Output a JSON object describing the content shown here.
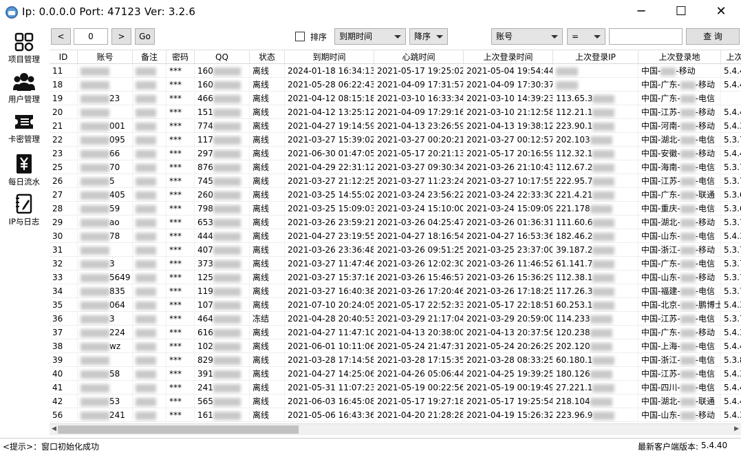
{
  "window": {
    "title": "Ip: 0.0.0.0  Port: 47123  Ver: 3.2.6",
    "minimize": "─",
    "maximize": "☐",
    "close": "✕"
  },
  "sidebar": {
    "items": [
      {
        "label": "项目管理",
        "icon": "grid-icon"
      },
      {
        "label": "用户管理",
        "icon": "users-icon"
      },
      {
        "label": "卡密管理",
        "icon": "ticket-icon"
      },
      {
        "label": "每日流水",
        "icon": "yen-icon"
      },
      {
        "label": "IP与日志",
        "icon": "notebook-icon"
      }
    ]
  },
  "toolbar": {
    "prev": "<",
    "page": "0",
    "next": ">",
    "go": "Go",
    "sort_label": "排序",
    "sort_field": "到期时间",
    "sort_order": "降序",
    "filter_field": "账号",
    "filter_op": "=",
    "filter_value": "",
    "query": "查 询"
  },
  "table": {
    "columns": [
      "ID",
      "账号",
      "备注",
      "密码",
      "QQ",
      "状态",
      "到期时间",
      "心跳时间",
      "上次登录时间",
      "上次登录IP",
      "上次登录地",
      "上次"
    ],
    "rows": [
      {
        "id": "11",
        "acct": "",
        "note": "",
        "pwd": "***",
        "qq": "160",
        "status": "离线",
        "expire": "2024-01-18 16:34:13",
        "beat": "2021-05-17 19:25:02",
        "last": "2021-05-04 19:54:44",
        "ip": "",
        "loc_a": "中国-",
        "loc_b": "-移动",
        "ver": "5.4.4"
      },
      {
        "id": "18",
        "acct": "",
        "note": "",
        "pwd": "***",
        "qq": "160",
        "status": "离线",
        "expire": "2021-05-28 06:22:43",
        "beat": "2021-04-09 17:31:57",
        "last": "2021-04-09 17:30:37",
        "ip": "",
        "loc_a": "中国-广东-",
        "loc_b": "-移动",
        "ver": "5.4.4"
      },
      {
        "id": "19",
        "acct": "23",
        "note": "",
        "pwd": "***",
        "qq": "466",
        "status": "离线",
        "expire": "2021-04-12 08:15:18",
        "beat": "2021-03-10 16:33:34",
        "last": "2021-03-10 14:39:23",
        "ip": "113.65.3",
        "loc_a": "中国-广东-",
        "loc_b": "-电信",
        "ver": ""
      },
      {
        "id": "20",
        "acct": "",
        "note": "",
        "pwd": "***",
        "qq": "151",
        "status": "离线",
        "expire": "2021-04-12 13:25:12",
        "beat": "2021-04-09 17:29:16",
        "last": "2021-03-10 21:12:58",
        "ip": "112.21.1",
        "loc_a": "中国-江苏-",
        "loc_b": "-移动",
        "ver": "5.4.4"
      },
      {
        "id": "21",
        "acct": "001",
        "note": "",
        "pwd": "***",
        "qq": "774",
        "status": "离线",
        "expire": "2021-04-27 19:14:59",
        "beat": "2021-04-13 23:26:59",
        "last": "2021-04-13 19:38:12",
        "ip": "223.90.1",
        "loc_a": "中国-河南-",
        "loc_b": "-移动",
        "ver": "5.4.3"
      },
      {
        "id": "22",
        "acct": "095",
        "note": "",
        "pwd": "***",
        "qq": "117",
        "status": "离线",
        "expire": "2021-03-27 15:39:02",
        "beat": "2021-03-27 00:20:21",
        "last": "2021-03-27 00:12:57",
        "ip": "202.103",
        "loc_a": "中国-湖北-",
        "loc_b": "-电信",
        "ver": "5.3.7"
      },
      {
        "id": "23",
        "acct": "66",
        "note": "",
        "pwd": "***",
        "qq": "297",
        "status": "离线",
        "expire": "2021-06-30 01:47:05",
        "beat": "2021-05-17 20:21:13",
        "last": "2021-05-17 20:16:59",
        "ip": "112.32.1",
        "loc_a": "中国-安徽-",
        "loc_b": "-移动",
        "ver": "5.4.4"
      },
      {
        "id": "25",
        "acct": "70",
        "note": "",
        "pwd": "***",
        "qq": "876",
        "status": "离线",
        "expire": "2021-04-29 22:31:12",
        "beat": "2021-03-27 09:30:34",
        "last": "2021-03-26 21:10:43",
        "ip": "112.67.2",
        "loc_a": "中国-海南-",
        "loc_b": "-电信",
        "ver": "5.3.7"
      },
      {
        "id": "26",
        "acct": "5",
        "note": "",
        "pwd": "***",
        "qq": "745",
        "status": "离线",
        "expire": "2021-03-27 21:12:25",
        "beat": "2021-03-27 11:23:24",
        "last": "2021-03-27 10:17:55",
        "ip": "222.95.7",
        "loc_a": "中国-江苏-",
        "loc_b": "-电信",
        "ver": "5.3.7"
      },
      {
        "id": "27",
        "acct": "405",
        "note": "",
        "pwd": "***",
        "qq": "260",
        "status": "离线",
        "expire": "2021-03-25 14:55:02",
        "beat": "2021-03-24 23:56:22",
        "last": "2021-03-24 22:33:30",
        "ip": "221.4.21",
        "loc_a": "中国-广东-",
        "loc_b": "-联通",
        "ver": "5.3.6"
      },
      {
        "id": "28",
        "acct": "59",
        "note": "",
        "pwd": "***",
        "qq": "798",
        "status": "离线",
        "expire": "2021-03-25 15:09:03",
        "beat": "2021-03-24 15:10:00",
        "last": "2021-03-24 15:09:09",
        "ip": "221.178",
        "loc_a": "中国-重庆-",
        "loc_b": "-电信",
        "ver": "5.3.6"
      },
      {
        "id": "29",
        "acct": "ao",
        "note": "",
        "pwd": "***",
        "qq": "653",
        "status": "离线",
        "expire": "2021-03-26 23:59:21",
        "beat": "2021-03-26 04:25:47",
        "last": "2021-03-26 01:36:31",
        "ip": "111.60.6",
        "loc_a": "中国-湖北-",
        "loc_b": "-移动",
        "ver": "5.3.7"
      },
      {
        "id": "30",
        "acct": "78",
        "note": "",
        "pwd": "***",
        "qq": "444",
        "status": "离线",
        "expire": "2021-04-27 23:19:55",
        "beat": "2021-04-27 18:16:54",
        "last": "2021-04-27 16:53:36",
        "ip": "182.46.2",
        "loc_a": "中国-山东-",
        "loc_b": "-电信",
        "ver": "5.4.3"
      },
      {
        "id": "31",
        "acct": "",
        "note": "",
        "pwd": "***",
        "qq": "407",
        "status": "离线",
        "expire": "2021-03-26 23:36:48",
        "beat": "2021-03-26 09:51:25",
        "last": "2021-03-25 23:37:00",
        "ip": "39.187.2",
        "loc_a": "中国-浙江-",
        "loc_b": "-移动",
        "ver": "5.3.7"
      },
      {
        "id": "32",
        "acct": "3",
        "note": "",
        "pwd": "***",
        "qq": "373",
        "status": "离线",
        "expire": "2021-03-27 11:47:46",
        "beat": "2021-03-26 12:02:30",
        "last": "2021-03-26 11:46:52",
        "ip": "61.141.7",
        "loc_a": "中国-广东-",
        "loc_b": "-电信",
        "ver": "5.3.7"
      },
      {
        "id": "33",
        "acct": "5649",
        "note": "",
        "pwd": "***",
        "qq": "125",
        "status": "离线",
        "expire": "2021-03-27 15:37:16",
        "beat": "2021-03-26 15:46:57",
        "last": "2021-03-26 15:36:29",
        "ip": "112.38.1",
        "loc_a": "中国-山东-",
        "loc_b": "-移动",
        "ver": "5.3.7"
      },
      {
        "id": "34",
        "acct": "835",
        "note": "",
        "pwd": "***",
        "qq": "119",
        "status": "离线",
        "expire": "2021-03-27 16:40:38",
        "beat": "2021-03-26 17:20:46",
        "last": "2021-03-26 17:18:25",
        "ip": "117.26.3",
        "loc_a": "中国-福建-",
        "loc_b": "-电信",
        "ver": "5.3.7"
      },
      {
        "id": "35",
        "acct": "064",
        "note": "",
        "pwd": "***",
        "qq": "107",
        "status": "离线",
        "expire": "2021-07-10 20:24:05",
        "beat": "2021-05-17 22:52:33",
        "last": "2021-05-17 22:18:51",
        "ip": "60.253.1",
        "loc_a": "中国-北京-",
        "loc_b": "-鹏博士",
        "ver": "5.4.3"
      },
      {
        "id": "36",
        "acct": "3",
        "note": "",
        "pwd": "***",
        "qq": "464",
        "status": "冻结",
        "expire": "2021-04-28 20:40:53",
        "beat": "2021-03-29 21:17:04",
        "last": "2021-03-29 20:59:00",
        "ip": "114.233",
        "loc_a": "中国-江苏-",
        "loc_b": "-电信",
        "ver": "5.3.7"
      },
      {
        "id": "37",
        "acct": "224",
        "note": "",
        "pwd": "***",
        "qq": "616",
        "status": "离线",
        "expire": "2021-04-27 11:47:10",
        "beat": "2021-04-13 20:38:00",
        "last": "2021-04-13 20:37:56",
        "ip": "120.238",
        "loc_a": "中国-广东-",
        "loc_b": "-移动",
        "ver": "5.4.3"
      },
      {
        "id": "38",
        "acct": "wz",
        "note": "",
        "pwd": "***",
        "qq": "102",
        "status": "离线",
        "expire": "2021-06-01 10:11:06",
        "beat": "2021-05-24 21:47:31",
        "last": "2021-05-24 20:26:29",
        "ip": "202.120",
        "loc_a": "中国-上海-",
        "loc_b": "-电信",
        "ver": "5.4.4"
      },
      {
        "id": "39",
        "acct": "",
        "note": "",
        "pwd": "***",
        "qq": "829",
        "status": "离线",
        "expire": "2021-03-28 17:14:58",
        "beat": "2021-03-28 17:15:35",
        "last": "2021-03-28 08:33:25",
        "ip": "60.180.1",
        "loc_a": "中国-浙江-",
        "loc_b": "-电信",
        "ver": "5.3.8"
      },
      {
        "id": "40",
        "acct": "58",
        "note": "",
        "pwd": "***",
        "qq": "391",
        "status": "离线",
        "expire": "2021-04-27 14:25:06",
        "beat": "2021-04-26 05:06:44",
        "last": "2021-04-25 19:39:25",
        "ip": "180.126",
        "loc_a": "中国-江苏-",
        "loc_b": "-电信",
        "ver": "5.4.3"
      },
      {
        "id": "41",
        "acct": "",
        "note": "",
        "pwd": "***",
        "qq": "241",
        "status": "离线",
        "expire": "2021-05-31 11:07:23",
        "beat": "2021-05-19 00:22:56",
        "last": "2021-05-19 00:19:49",
        "ip": "27.221.1",
        "loc_a": "中国-四川-",
        "loc_b": "-电信",
        "ver": "5.4.4"
      },
      {
        "id": "42",
        "acct": "53",
        "note": "",
        "pwd": "***",
        "qq": "565",
        "status": "离线",
        "expire": "2021-06-03 16:45:08",
        "beat": "2021-05-17 19:27:18",
        "last": "2021-05-17 19:25:54",
        "ip": "218.104",
        "loc_a": "中国-湖北-",
        "loc_b": "-联通",
        "ver": "5.4.4"
      },
      {
        "id": "56",
        "acct": "241",
        "note": "",
        "pwd": "***",
        "qq": "161",
        "status": "离线",
        "expire": "2021-05-06 16:43:36",
        "beat": "2021-04-20 21:28:28",
        "last": "2021-04-19 15:26:32",
        "ip": "223.96.9",
        "loc_a": "中国-山东-",
        "loc_b": "-移动",
        "ver": "5.4.3"
      }
    ]
  },
  "status": {
    "hint_label": "<提示>：",
    "hint_text": "窗口初始化成功",
    "latest_label": "最新客户端版本:",
    "latest_version": "5.4.40"
  }
}
